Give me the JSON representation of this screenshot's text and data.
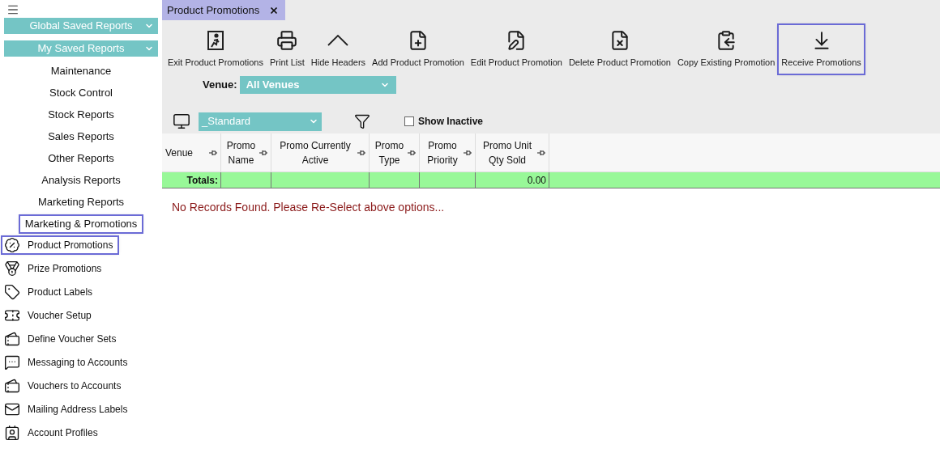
{
  "sidebar": {
    "dropdowns": [
      {
        "label": "Global Saved Reports"
      },
      {
        "label": "My Saved Reports"
      }
    ],
    "sections": [
      {
        "label": "Maintenance",
        "highlighted": false
      },
      {
        "label": "Stock Control",
        "highlighted": false
      },
      {
        "label": "Stock Reports",
        "highlighted": false
      },
      {
        "label": "Sales Reports",
        "highlighted": false
      },
      {
        "label": "Other Reports",
        "highlighted": false
      },
      {
        "label": "Analysis Reports",
        "highlighted": false
      },
      {
        "label": "Marketing Reports",
        "highlighted": false
      },
      {
        "label": "Marketing & Promotions",
        "highlighted": true
      }
    ],
    "items": [
      {
        "label": "Product Promotions",
        "highlighted": true
      },
      {
        "label": "Prize Promotions",
        "highlighted": false
      },
      {
        "label": "Product Labels",
        "highlighted": false
      },
      {
        "label": "Voucher Setup",
        "highlighted": false
      },
      {
        "label": "Define Voucher Sets",
        "highlighted": false
      },
      {
        "label": "Messaging to Accounts",
        "highlighted": false
      },
      {
        "label": "Vouchers to Accounts",
        "highlighted": false
      },
      {
        "label": "Mailing Address Labels",
        "highlighted": false
      },
      {
        "label": "Account Profiles",
        "highlighted": false
      }
    ]
  },
  "tab": {
    "title": "Product Promotions"
  },
  "toolbar": [
    {
      "label": "Exit Product Promotions",
      "highlighted": false
    },
    {
      "label": "Print List",
      "highlighted": false
    },
    {
      "label": "Hide Headers",
      "highlighted": false
    },
    {
      "label": "Add Product Promotion",
      "highlighted": false
    },
    {
      "label": "Edit Product Promotion",
      "highlighted": false
    },
    {
      "label": "Delete Product Promotion",
      "highlighted": false
    },
    {
      "label": "Copy Existing Promotion",
      "highlighted": false
    },
    {
      "label": "Receive Promotions",
      "highlighted": true
    }
  ],
  "venue": {
    "label": "Venue:",
    "value": "All Venues"
  },
  "layout_select": {
    "value": "_Standard"
  },
  "show_inactive": {
    "label": "Show Inactive",
    "checked": false
  },
  "table": {
    "columns": [
      {
        "label": "Venue"
      },
      {
        "label": "Promo Name"
      },
      {
        "label": "Promo Currently Active"
      },
      {
        "label": "Promo Type"
      },
      {
        "label": "Promo Priority"
      },
      {
        "label": "Promo Unit Qty Sold",
        "total": "0.00"
      }
    ],
    "totals_label": "Totals:"
  },
  "message": "No Records Found. Please Re-Select above options..."
}
